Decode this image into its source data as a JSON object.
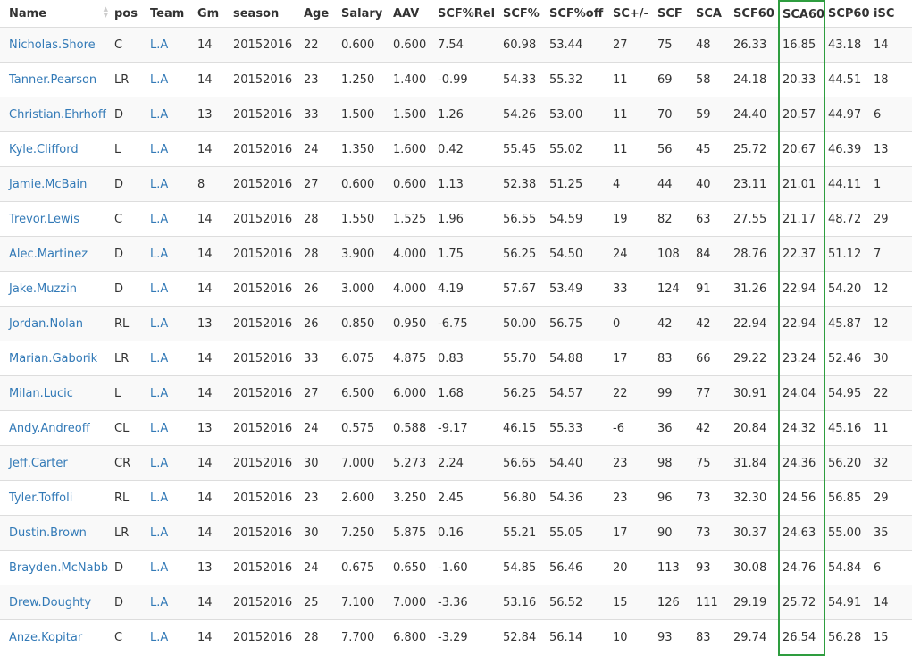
{
  "table": {
    "highlight_color": "#2e9d3f",
    "link_color": "#337ab7",
    "sorted_column": "SCA60",
    "sort_direction": "ascending",
    "columns": [
      "Name",
      "pos",
      "Team",
      "Gm",
      "season",
      "Age",
      "Salary",
      "AAV",
      "SCF%Rel",
      "SCF%",
      "SCF%off",
      "SC+/-",
      "SCF",
      "SCA",
      "SCF60",
      "SCA60",
      "SCP60",
      "iSC"
    ],
    "rows": [
      [
        "Nicholas.Shore",
        "C",
        "L.A",
        "14",
        "20152016",
        "22",
        "0.600",
        "0.600",
        "7.54",
        "60.98",
        "53.44",
        "27",
        "75",
        "48",
        "26.33",
        "16.85",
        "43.18",
        "14"
      ],
      [
        "Tanner.Pearson",
        "LR",
        "L.A",
        "14",
        "20152016",
        "23",
        "1.250",
        "1.400",
        "-0.99",
        "54.33",
        "55.32",
        "11",
        "69",
        "58",
        "24.18",
        "20.33",
        "44.51",
        "18"
      ],
      [
        "Christian.Ehrhoff",
        "D",
        "L.A",
        "13",
        "20152016",
        "33",
        "1.500",
        "1.500",
        "1.26",
        "54.26",
        "53.00",
        "11",
        "70",
        "59",
        "24.40",
        "20.57",
        "44.97",
        "6"
      ],
      [
        "Kyle.Clifford",
        "L",
        "L.A",
        "14",
        "20152016",
        "24",
        "1.350",
        "1.600",
        "0.42",
        "55.45",
        "55.02",
        "11",
        "56",
        "45",
        "25.72",
        "20.67",
        "46.39",
        "13"
      ],
      [
        "Jamie.McBain",
        "D",
        "L.A",
        "8",
        "20152016",
        "27",
        "0.600",
        "0.600",
        "1.13",
        "52.38",
        "51.25",
        "4",
        "44",
        "40",
        "23.11",
        "21.01",
        "44.11",
        "1"
      ],
      [
        "Trevor.Lewis",
        "C",
        "L.A",
        "14",
        "20152016",
        "28",
        "1.550",
        "1.525",
        "1.96",
        "56.55",
        "54.59",
        "19",
        "82",
        "63",
        "27.55",
        "21.17",
        "48.72",
        "29"
      ],
      [
        "Alec.Martinez",
        "D",
        "L.A",
        "14",
        "20152016",
        "28",
        "3.900",
        "4.000",
        "1.75",
        "56.25",
        "54.50",
        "24",
        "108",
        "84",
        "28.76",
        "22.37",
        "51.12",
        "7"
      ],
      [
        "Jake.Muzzin",
        "D",
        "L.A",
        "14",
        "20152016",
        "26",
        "3.000",
        "4.000",
        "4.19",
        "57.67",
        "53.49",
        "33",
        "124",
        "91",
        "31.26",
        "22.94",
        "54.20",
        "12"
      ],
      [
        "Jordan.Nolan",
        "RL",
        "L.A",
        "13",
        "20152016",
        "26",
        "0.850",
        "0.950",
        "-6.75",
        "50.00",
        "56.75",
        "0",
        "42",
        "42",
        "22.94",
        "22.94",
        "45.87",
        "12"
      ],
      [
        "Marian.Gaborik",
        "LR",
        "L.A",
        "14",
        "20152016",
        "33",
        "6.075",
        "4.875",
        "0.83",
        "55.70",
        "54.88",
        "17",
        "83",
        "66",
        "29.22",
        "23.24",
        "52.46",
        "30"
      ],
      [
        "Milan.Lucic",
        "L",
        "L.A",
        "14",
        "20152016",
        "27",
        "6.500",
        "6.000",
        "1.68",
        "56.25",
        "54.57",
        "22",
        "99",
        "77",
        "30.91",
        "24.04",
        "54.95",
        "22"
      ],
      [
        "Andy.Andreoff",
        "CL",
        "L.A",
        "13",
        "20152016",
        "24",
        "0.575",
        "0.588",
        "-9.17",
        "46.15",
        "55.33",
        "-6",
        "36",
        "42",
        "20.84",
        "24.32",
        "45.16",
        "11"
      ],
      [
        "Jeff.Carter",
        "CR",
        "L.A",
        "14",
        "20152016",
        "30",
        "7.000",
        "5.273",
        "2.24",
        "56.65",
        "54.40",
        "23",
        "98",
        "75",
        "31.84",
        "24.36",
        "56.20",
        "32"
      ],
      [
        "Tyler.Toffoli",
        "RL",
        "L.A",
        "14",
        "20152016",
        "23",
        "2.600",
        "3.250",
        "2.45",
        "56.80",
        "54.36",
        "23",
        "96",
        "73",
        "32.30",
        "24.56",
        "56.85",
        "29"
      ],
      [
        "Dustin.Brown",
        "LR",
        "L.A",
        "14",
        "20152016",
        "30",
        "7.250",
        "5.875",
        "0.16",
        "55.21",
        "55.05",
        "17",
        "90",
        "73",
        "30.37",
        "24.63",
        "55.00",
        "35"
      ],
      [
        "Brayden.McNabb",
        "D",
        "L.A",
        "13",
        "20152016",
        "24",
        "0.675",
        "0.650",
        "-1.60",
        "54.85",
        "56.46",
        "20",
        "113",
        "93",
        "30.08",
        "24.76",
        "54.84",
        "6"
      ],
      [
        "Drew.Doughty",
        "D",
        "L.A",
        "14",
        "20152016",
        "25",
        "7.100",
        "7.000",
        "-3.36",
        "53.16",
        "56.52",
        "15",
        "126",
        "111",
        "29.19",
        "25.72",
        "54.91",
        "14"
      ],
      [
        "Anze.Kopitar",
        "C",
        "L.A",
        "14",
        "20152016",
        "28",
        "7.700",
        "6.800",
        "-3.29",
        "52.84",
        "56.14",
        "10",
        "93",
        "83",
        "29.74",
        "26.54",
        "56.28",
        "15"
      ]
    ]
  }
}
